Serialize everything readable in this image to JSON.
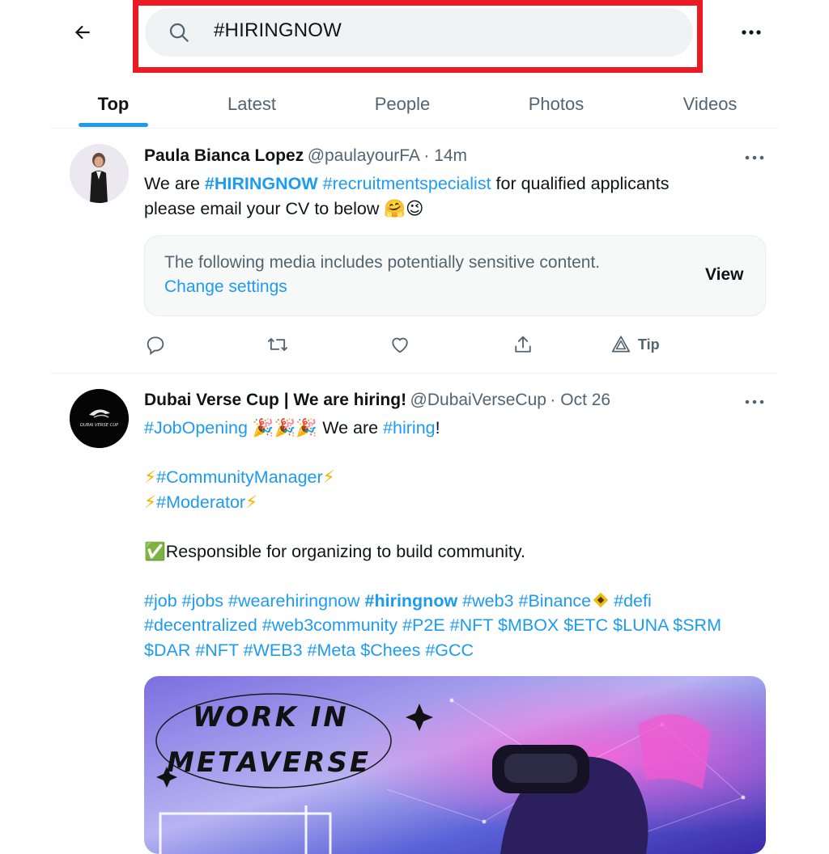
{
  "header": {
    "search_value": "#HIRINGNOW",
    "back_icon": "back-arrow-icon",
    "more_icon": "more-horizontal-icon",
    "highlight_color": "#ec1b23"
  },
  "tabs": [
    {
      "label": "Top",
      "active": true
    },
    {
      "label": "Latest",
      "active": false
    },
    {
      "label": "People",
      "active": false
    },
    {
      "label": "Photos",
      "active": false
    },
    {
      "label": "Videos",
      "active": false
    }
  ],
  "tweets": [
    {
      "name": "Paula Bianca Lopez",
      "handle": "@paulayourFA",
      "time": "· 14m",
      "text": {
        "t1": "We are ",
        "h1": "#HIRINGNOW",
        "h2": "#recruitmentspecialist",
        "t2": " for qualified applicants",
        "line2": "please email your CV to below 🤗😉"
      },
      "sensitive": {
        "notice": "The following media includes potentially sensitive content.",
        "change": "Change settings",
        "view": "View"
      },
      "actions": {
        "reply": "reply-icon",
        "retweet": "retweet-icon",
        "like": "like-icon",
        "share": "share-icon",
        "tip": "Tip"
      }
    },
    {
      "name": "Dubai Verse Cup | We are hiring!",
      "handle": "@DubaiVerseCup",
      "time": "· Oct 26",
      "avatar_text": "DUBAI VERSE CUP",
      "lines": {
        "l1_tag": "#JobOpening",
        "l1_emoji": " 🎉🎉🎉 ",
        "l1_text": "We are ",
        "l1_tag2": "#hiring",
        "l1_end": "!",
        "l2_tag": "#CommunityManager",
        "l3_tag": "#Moderator",
        "bolt": "⚡",
        "check": "✅",
        "l4_text": "Responsible for organizing to build community.",
        "tags_a": "#job #jobs #wearehiringnow ",
        "tags_a_bold": "#hiringnow",
        "tags_a2": " #web3 #Binance",
        "tags_a3": " #defi",
        "tags_b": "#decentralized #web3community #P2E #NFT $MBOX $ETC $LUNA $SRM",
        "tags_c": "$DAR #NFT #WEB3 #Meta $Chees #GCC"
      },
      "media": {
        "line1": "WORK IN",
        "line2": "METAVERSE"
      }
    }
  ]
}
